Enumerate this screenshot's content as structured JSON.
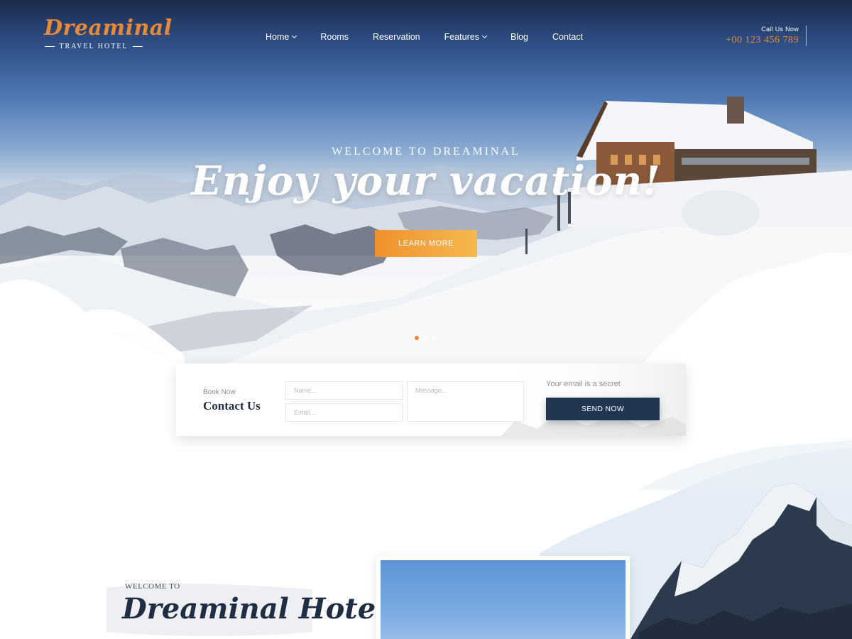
{
  "brand": {
    "name": "Dreaminal",
    "tagline": "TRAVEL HOTEL",
    "accent_color": "#e8893a",
    "dark_color": "#1f3550"
  },
  "nav": {
    "items": [
      {
        "label": "Home",
        "has_dropdown": true
      },
      {
        "label": "Rooms",
        "has_dropdown": false
      },
      {
        "label": "Reservation",
        "has_dropdown": false
      },
      {
        "label": "Features",
        "has_dropdown": true
      },
      {
        "label": "Blog",
        "has_dropdown": false
      },
      {
        "label": "Contact",
        "has_dropdown": false
      }
    ]
  },
  "call": {
    "label": "Call Us Now",
    "number": "+00 123 456 789"
  },
  "hero": {
    "welcome": "WELCOME TO DREAMINAL",
    "headline": "Enjoy your vacation!",
    "button_label": "LEARN MORE",
    "slides": 3,
    "active_slide": 1
  },
  "contact_form": {
    "eyebrow": "Book Now",
    "title": "Contact Us",
    "name_placeholder": "Name...",
    "email_placeholder": "Email...",
    "message_placeholder": "Massage...",
    "note": "Your email is a secret",
    "send_label": "SEND NOW"
  },
  "about": {
    "eyebrow": "WELCOME TO",
    "title": "Dreaminal Hotel"
  }
}
